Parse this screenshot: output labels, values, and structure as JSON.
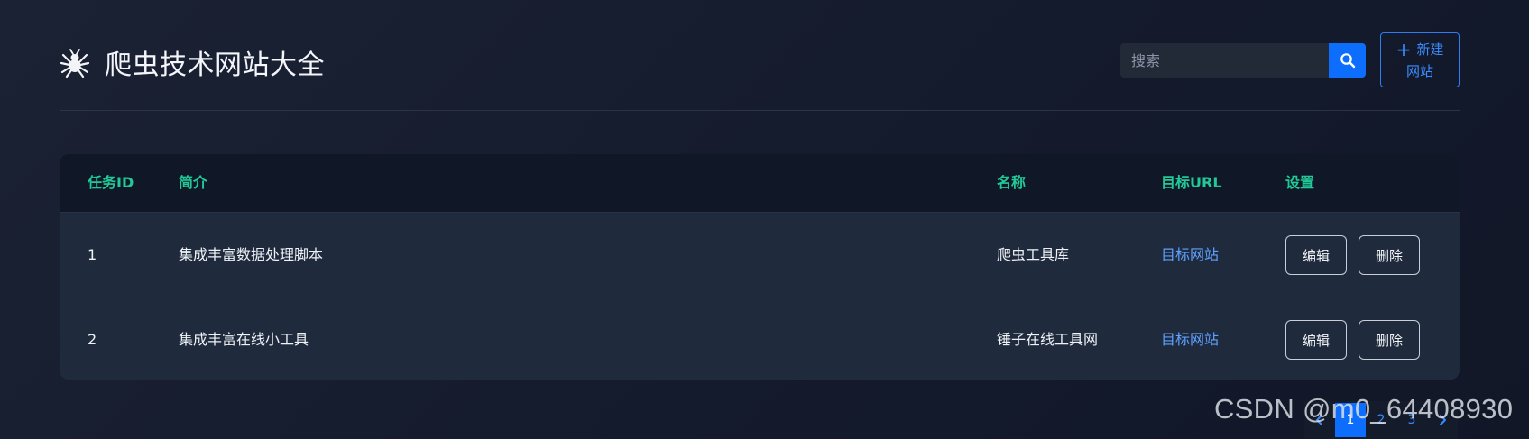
{
  "header": {
    "icon": "spider-icon",
    "title": "爬虫技术网站大全"
  },
  "search": {
    "placeholder": "搜索",
    "value": "",
    "button_icon": "search-icon"
  },
  "new_button": {
    "icon": "plus-icon",
    "label_line1": "新建",
    "label_line2": "网站"
  },
  "table": {
    "columns": [
      "任务ID",
      "简介",
      "名称",
      "目标URL",
      "设置"
    ],
    "rows": [
      {
        "id": "1",
        "desc": "集成丰富数据处理脚本",
        "name": "爬虫工具库",
        "url_label": "目标网站",
        "edit_label": "编辑",
        "delete_label": "删除"
      },
      {
        "id": "2",
        "desc": "集成丰富在线小工具",
        "name": "锤子在线工具网",
        "url_label": "目标网站",
        "edit_label": "编辑",
        "delete_label": "删除"
      }
    ]
  },
  "pagination": {
    "prev_icon": "chevron-left-icon",
    "pages": [
      "1",
      "2",
      "3"
    ],
    "active_page": "1",
    "next_icon": "chevron-right-icon"
  },
  "watermark": "CSDN @m0_64408930",
  "colors": {
    "accent": "#0d6efd",
    "header_text": "#20c997",
    "link": "#5ea0ff"
  }
}
